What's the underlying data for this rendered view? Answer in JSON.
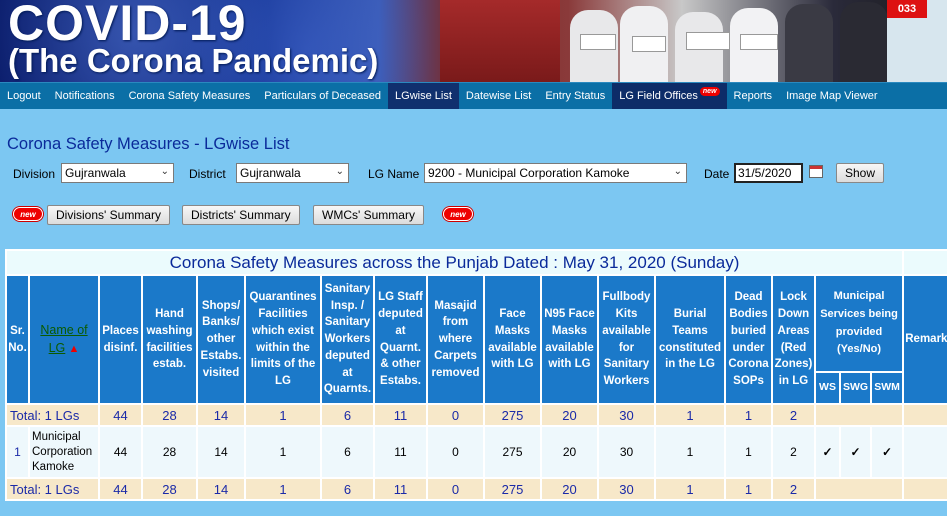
{
  "banner": {
    "title_line1": "COVID-19",
    "title_line2": "(The Corona Pandemic)"
  },
  "nav": {
    "items": [
      {
        "label": "Logout"
      },
      {
        "label": "Notifications"
      },
      {
        "label": "Corona Safety Measures"
      },
      {
        "label": "Particulars of Deceased"
      },
      {
        "label": "LGwise List"
      },
      {
        "label": "Datewise List"
      },
      {
        "label": "Entry Status"
      },
      {
        "label": "LG Field Offices"
      },
      {
        "label": "Reports"
      },
      {
        "label": "Image Map Viewer"
      }
    ],
    "new_badge": "new"
  },
  "page": {
    "title": "Corona Safety Measures - LGwise List"
  },
  "filters": {
    "division_label": "Division",
    "division_value": "Gujranwala",
    "district_label": "District",
    "district_value": "Gujranwala",
    "lg_label": "LG Name",
    "lg_value": "9200 - Municipal Corporation Kamoke",
    "date_label": "Date",
    "date_value": "31/5/2020",
    "show_button": "Show"
  },
  "summaries": {
    "new_label": "new",
    "divisions": "Divisions' Summary",
    "districts": "Districts' Summary",
    "wmcs": "WMCs' Summary"
  },
  "table": {
    "caption": "Corona Safety Measures across the Punjab Dated : May 31, 2020 (Sunday)",
    "headers": {
      "sr": "Sr. No.",
      "name": "Name of LG",
      "places": "Places disinf.",
      "hand": "Hand washing facilities estab.",
      "shops": "Shops/ Banks/ other Estabs. visited",
      "quarantines": "Quarantines Facilities which exist within the limits of the LG",
      "sanitary": "Sanitary Insp. / Sanitary Workers deputed at Quarnts.",
      "lgstaff": "LG Staff deputed at Quarnt. & other Estabs.",
      "masajid": "Masajid from where Carpets removed",
      "facemasks": "Face Masks available with LG",
      "n95": "N95 Face Masks available with LG",
      "fullbody": "Fullbody Kits available for Sanitary Workers",
      "burial": "Burial Teams constituted in the LG",
      "dead": "Dead Bodies buried under Corona SOPs",
      "lockdown": "Lock Down Areas (Red Zones) in LG",
      "municipal": "Municipal Services being provided (Yes/No)",
      "ws": "WS",
      "swg": "SWG",
      "swm": "SWM",
      "remarks": "Remarks"
    },
    "total_label": "Total: 1 LGs",
    "totals": [
      "44",
      "28",
      "14",
      "1",
      "6",
      "11",
      "0",
      "275",
      "20",
      "30",
      "1",
      "1",
      "2"
    ],
    "rows": [
      {
        "sr": "1",
        "name": "Municipal Corporation Kamoke",
        "values": [
          "44",
          "28",
          "14",
          "1",
          "6",
          "11",
          "0",
          "275",
          "20",
          "30",
          "1",
          "1",
          "2"
        ],
        "ws": "✓",
        "swg": "✓",
        "swm": "✓",
        "remarks": ""
      }
    ]
  }
}
